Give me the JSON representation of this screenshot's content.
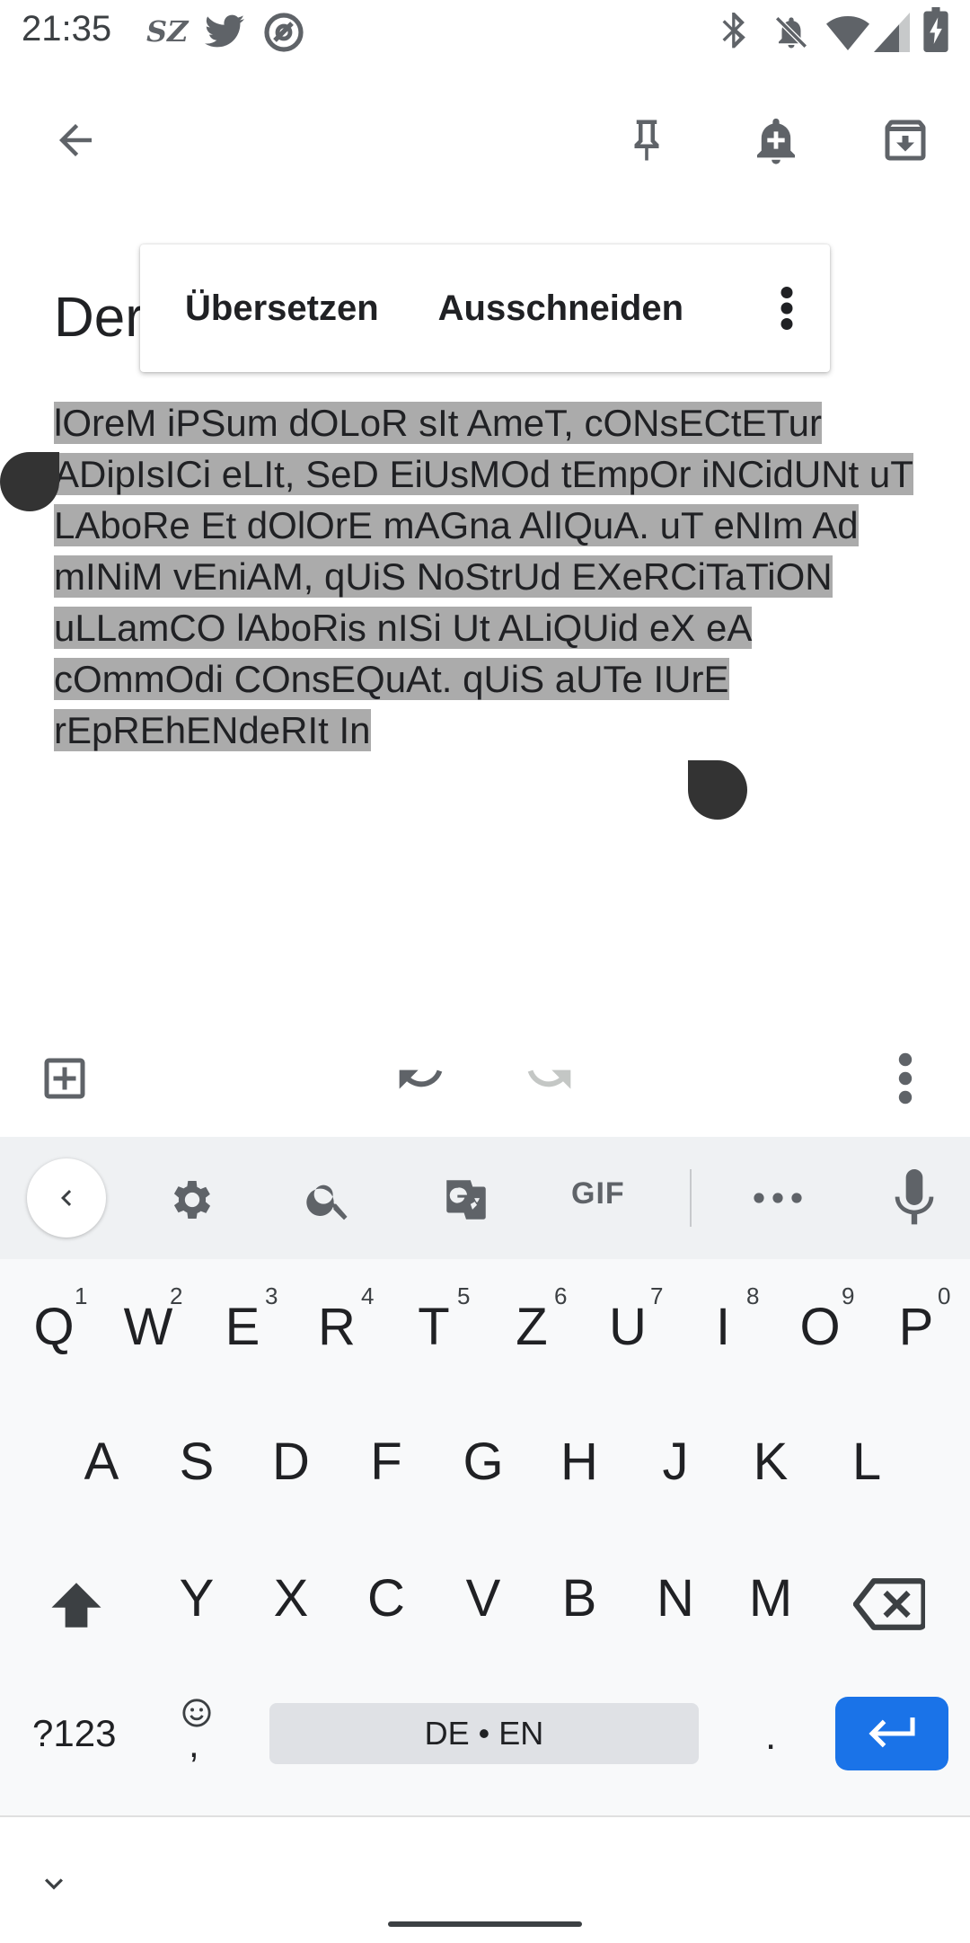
{
  "status": {
    "time": "21:35",
    "app_badge": "SZ"
  },
  "note": {
    "title_visible": "Der",
    "body": "lOreM iPSum dOLoR sIt AmeT, cONsECtETur ADipIsICi eLIt, SeD EiUsMOd tEmpOr iNCidUNt uT LAboRe Et dOlOrE mAGna AlIQuA. uT eNIm Ad mINiM vEniAM, qUiS NoStrUd EXeRCiTaTiON uLLamCO lAboRis nISi Ut ALiQUid eX eA cOmmOdi COnsEQuAt. qUiS aUTe IUrE rEpREhENdeRIt In"
  },
  "context_menu": {
    "translate": "Übersetzen",
    "cut": "Ausschneiden"
  },
  "keyboard": {
    "row1": [
      "Q",
      "W",
      "E",
      "R",
      "T",
      "Z",
      "U",
      "I",
      "O",
      "P"
    ],
    "row1_hints": [
      "1",
      "2",
      "3",
      "4",
      "5",
      "6",
      "7",
      "8",
      "9",
      "0"
    ],
    "row2": [
      "A",
      "S",
      "D",
      "F",
      "G",
      "H",
      "J",
      "K",
      "L"
    ],
    "row3": [
      "Y",
      "X",
      "C",
      "V",
      "B",
      "N",
      "M"
    ],
    "symbols_label": "?123",
    "comma": ",",
    "period": ".",
    "space_label": "DE • EN",
    "gif_label": "GIF"
  },
  "colors": {
    "selection": "#ababab",
    "enter_key": "#1a73e8",
    "handle": "#333333"
  }
}
